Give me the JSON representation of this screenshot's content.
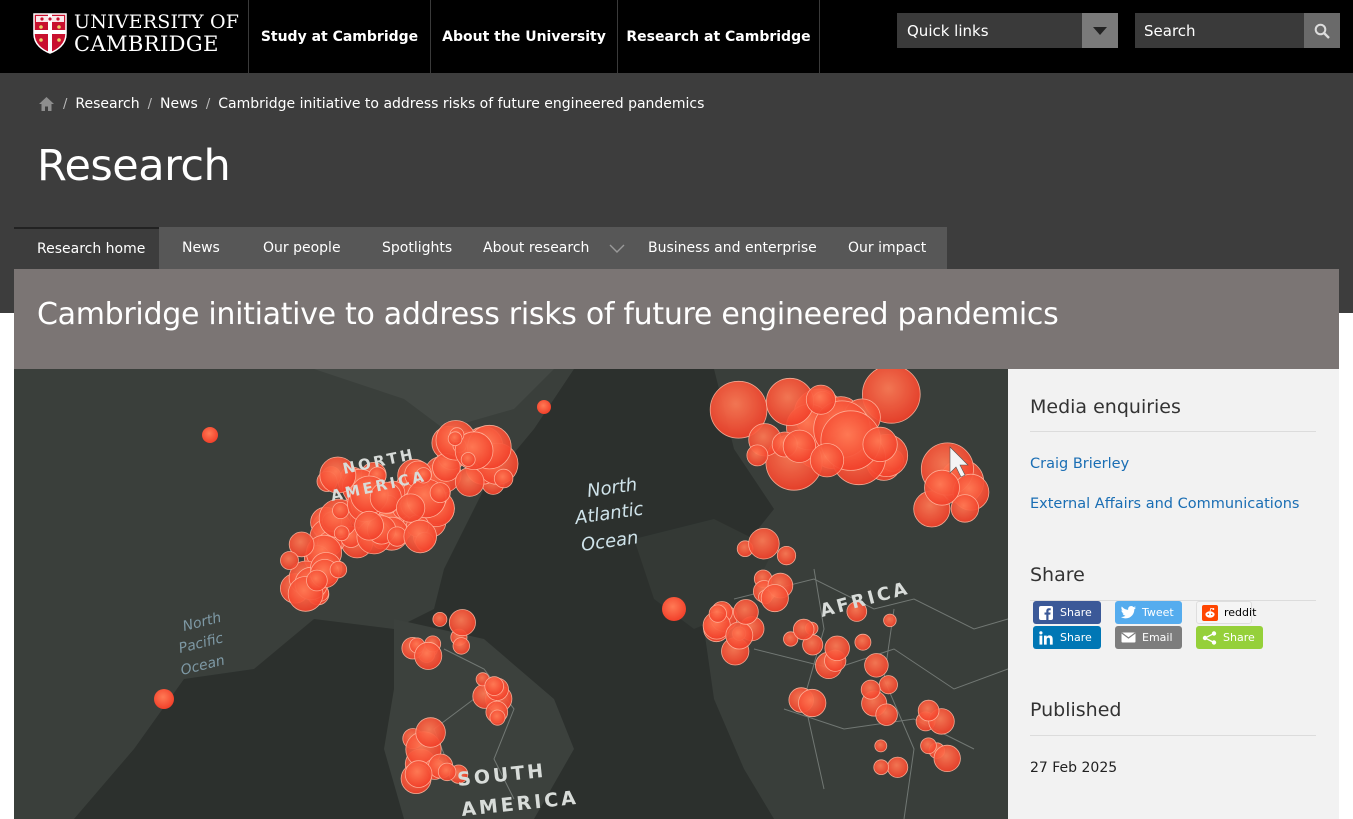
{
  "header": {
    "logo_line1": "UNIVERSITY OF",
    "logo_line2": "CAMBRIDGE",
    "nav": [
      {
        "label": "Study at Cambridge"
      },
      {
        "label": "About the University"
      },
      {
        "label": "Research at Cambridge"
      }
    ],
    "quick_links_label": "Quick links",
    "search_placeholder": "Search"
  },
  "breadcrumb": {
    "items": [
      "Research",
      "News",
      "Cambridge initiative to address risks of future engineered pandemics"
    ]
  },
  "section_title": "Research",
  "subnav": [
    {
      "label": "Research home"
    },
    {
      "label": "News"
    },
    {
      "label": "Our people"
    },
    {
      "label": "Spotlights"
    },
    {
      "label": "About research"
    },
    {
      "label": "Business and enterprise"
    },
    {
      "label": "Our impact"
    }
  ],
  "article_title": "Cambridge initiative to address risks of future engineered pandemics",
  "hero_map": {
    "labels": [
      "NORTH",
      "AMERICA",
      "North",
      "Atlantic",
      "Ocean",
      "North",
      "Pacific",
      "Ocean",
      "AFRICA",
      "SOUTH",
      "AMERICA"
    ]
  },
  "sidebar": {
    "media_heading": "Media enquiries",
    "contact_name": "Craig Brierley",
    "contact_dept": "External Affairs and Communications",
    "share_heading": "Share",
    "share_buttons": {
      "facebook": "Share",
      "twitter": "Tweet",
      "reddit": "reddit",
      "linkedin": "Share",
      "email": "Email",
      "share": "Share"
    },
    "published_heading": "Published",
    "published_date": "27 Feb 2025"
  },
  "colors": {
    "header_bg": "#000000",
    "band_bg": "#3d3d3d",
    "title_bar_bg": "#7b7574",
    "link": "#1a6eb4",
    "facebook": "#3b5998",
    "twitter": "#55acee",
    "linkedin": "#0077b5",
    "email": "#7d7d7d",
    "share_green": "#95d03a",
    "reddit": "#ff4500"
  }
}
